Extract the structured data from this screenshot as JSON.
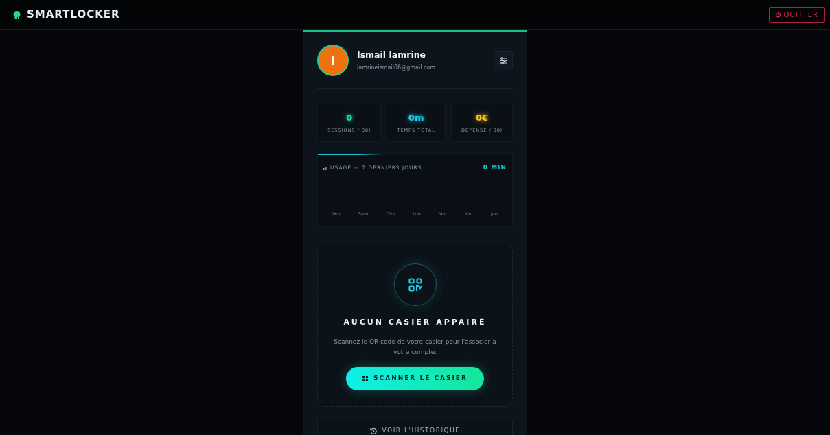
{
  "brand": "SMARTLOCKER",
  "logout_button": {
    "label": "QUITTER"
  },
  "profile": {
    "initial": "I",
    "name": "Ismail lamrine",
    "email": "lamrineismail06@gmail.com"
  },
  "stats": [
    {
      "value": "0",
      "label": "SESSIONS / 30J",
      "color": "#22e39a"
    },
    {
      "value": "0m",
      "label": "TEMPS TOTAL",
      "color": "#19d3f0"
    },
    {
      "value": "0€",
      "label": "DÉPENSÉ / 30J",
      "color": "#f5c518"
    }
  ],
  "usage": {
    "title": "USAGE — 7 DERNIERS JOURS",
    "total": "0 MIN",
    "days": [
      "Ven",
      "Sam",
      "Dim",
      "Lun",
      "Mar",
      "Mer",
      "Jeu"
    ]
  },
  "pairing": {
    "title": "AUCUN CASIER APPAIRÉ",
    "text": "Scannez le QR code de votre casier pour l'associer à votre compte.",
    "button": "SCANNER LE CASIER"
  },
  "history_button": "VOIR L'HISTORIQUE"
}
